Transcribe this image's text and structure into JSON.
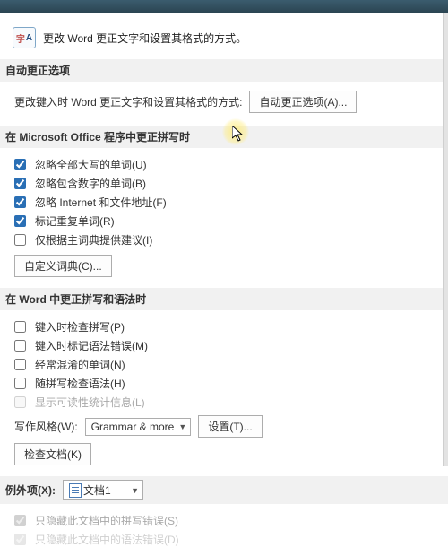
{
  "header": {
    "title": "更改 Word 更正文字和设置其格式的方式。"
  },
  "autocorrect": {
    "section_label": "自动更正选项",
    "desc": "更改键入时 Word 更正文字和设置其格式的方式:",
    "button": "自动更正选项(A)..."
  },
  "office_spell": {
    "section_label": "在 Microsoft Office 程序中更正拼写时",
    "ignore_uppercase": "忽略全部大写的单词(U)",
    "ignore_numbers": "忽略包含数字的单词(B)",
    "ignore_internet": "忽略 Internet 和文件地址(F)",
    "flag_repeated": "标记重复单词(R)",
    "main_dict_only": "仅根据主词典提供建议(I)",
    "custom_dict_btn": "自定义词典(C)..."
  },
  "word_spell": {
    "section_label": "在 Word 中更正拼写和语法时",
    "check_typing": "键入时检查拼写(P)",
    "mark_grammar_typing": "键入时标记语法错误(M)",
    "confused_words": "经常混淆的单词(N)",
    "grammar_with_spell": "随拼写检查语法(H)",
    "readability": "显示可读性统计信息(L)",
    "style_label": "写作风格(W):",
    "style_value": "Grammar & more",
    "settings_btn": "设置(T)...",
    "check_doc_btn": "检查文档(K)"
  },
  "exceptions": {
    "label": "例外项(X):",
    "doc_value": "文档1",
    "hide_spell": "只隐藏此文档中的拼写错误(S)",
    "hide_grammar": "只隐藏此文档中的语法错误(D)"
  }
}
